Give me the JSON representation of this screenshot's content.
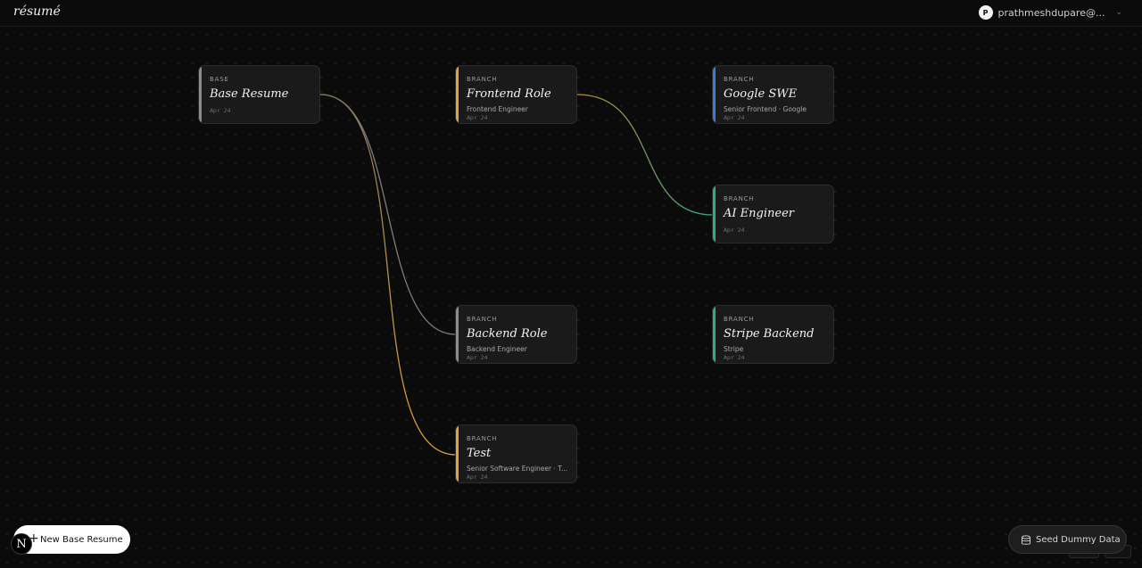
{
  "app": {
    "brand": "résumé"
  },
  "user": {
    "avatar_initial": "P",
    "email": "prathmeshdupare@..."
  },
  "nodes": [
    {
      "id": "base-resume",
      "kind": "BASE",
      "title": "Base Resume",
      "subtitle": "",
      "date": "Apr 24",
      "accent": "#8c8c8c"
    },
    {
      "id": "frontend-role",
      "kind": "BRANCH",
      "title": "Frontend Role",
      "subtitle": "Frontend Engineer",
      "date": "Apr 24",
      "accent": "#e0a23a"
    },
    {
      "id": "google-swe",
      "kind": "BRANCH",
      "title": "Google SWE",
      "subtitle": "Senior Frontend · Google",
      "date": "Apr 24",
      "accent": "#3b7be0"
    },
    {
      "id": "ai-engineer",
      "kind": "BRANCH",
      "title": "AI Engineer",
      "subtitle": "",
      "date": "Apr 24",
      "accent": "#2fae86"
    },
    {
      "id": "backend-role",
      "kind": "BRANCH",
      "title": "Backend Role",
      "subtitle": "Backend Engineer",
      "date": "Apr 24",
      "accent": "#8c8c8c"
    },
    {
      "id": "stripe-backend",
      "kind": "BRANCH",
      "title": "Stripe Backend",
      "subtitle": "Stripe",
      "date": "Apr 24",
      "accent": "#2fae86"
    },
    {
      "id": "test",
      "kind": "BRANCH",
      "title": "Test",
      "subtitle": "Senior Software Engineer · T...",
      "date": "Apr 24",
      "accent": "#e0a23a"
    }
  ],
  "edges": [
    {
      "from": "base-resume",
      "to": "frontend-role"
    },
    {
      "from": "base-resume",
      "to": "backend-role"
    },
    {
      "from": "base-resume",
      "to": "test"
    },
    {
      "from": "frontend-role",
      "to": "google-swe"
    },
    {
      "from": "frontend-role",
      "to": "ai-engineer"
    },
    {
      "from": "backend-role",
      "to": "stripe-backend"
    }
  ],
  "actions": {
    "new_base_resume": "New Base Resume",
    "seed_dummy_data": "Seed Dummy Data",
    "nextjs_badge": "N"
  },
  "icons": {
    "plus": "plus-icon",
    "database": "database-icon",
    "chevron": "chevron-down-icon"
  }
}
